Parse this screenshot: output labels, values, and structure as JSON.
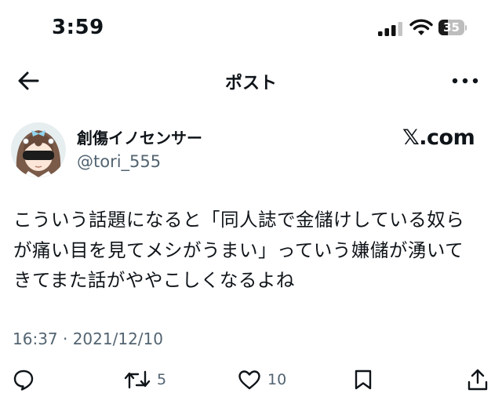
{
  "status_bar": {
    "time": "3:59",
    "battery_level": "35",
    "battery_fraction": 0.35,
    "icons": [
      "cellular-signal-icon",
      "wifi-icon",
      "battery-icon"
    ]
  },
  "header": {
    "title": "ポスト",
    "back_icon": "arrow-left-icon",
    "more_icon": "ellipsis-icon"
  },
  "author": {
    "display_name": "創傷イノセンサー",
    "handle": "@tori_555",
    "avatar": "user-avatar"
  },
  "source_label": "𝕏.com",
  "tweet": {
    "lines": [
      "こういう話題になると「同人誌で金儲けしている奴ら",
      "が痛い目を見てメシがうまい」っていう嫌儲が湧いて",
      "きてまた話がややこしくなるよね"
    ],
    "timestamp": "16:37 · 2021/12/10"
  },
  "actions": {
    "reply": {
      "icon": "reply-icon",
      "count": ""
    },
    "repost": {
      "icon": "repost-icon",
      "count": "5"
    },
    "like": {
      "icon": "heart-icon",
      "count": "10"
    },
    "bookmark": {
      "icon": "bookmark-icon",
      "count": ""
    },
    "share": {
      "icon": "share-icon",
      "count": ""
    }
  },
  "colors": {
    "text": "#0f1419",
    "secondary_text": "#536471",
    "background": "#ffffff"
  }
}
